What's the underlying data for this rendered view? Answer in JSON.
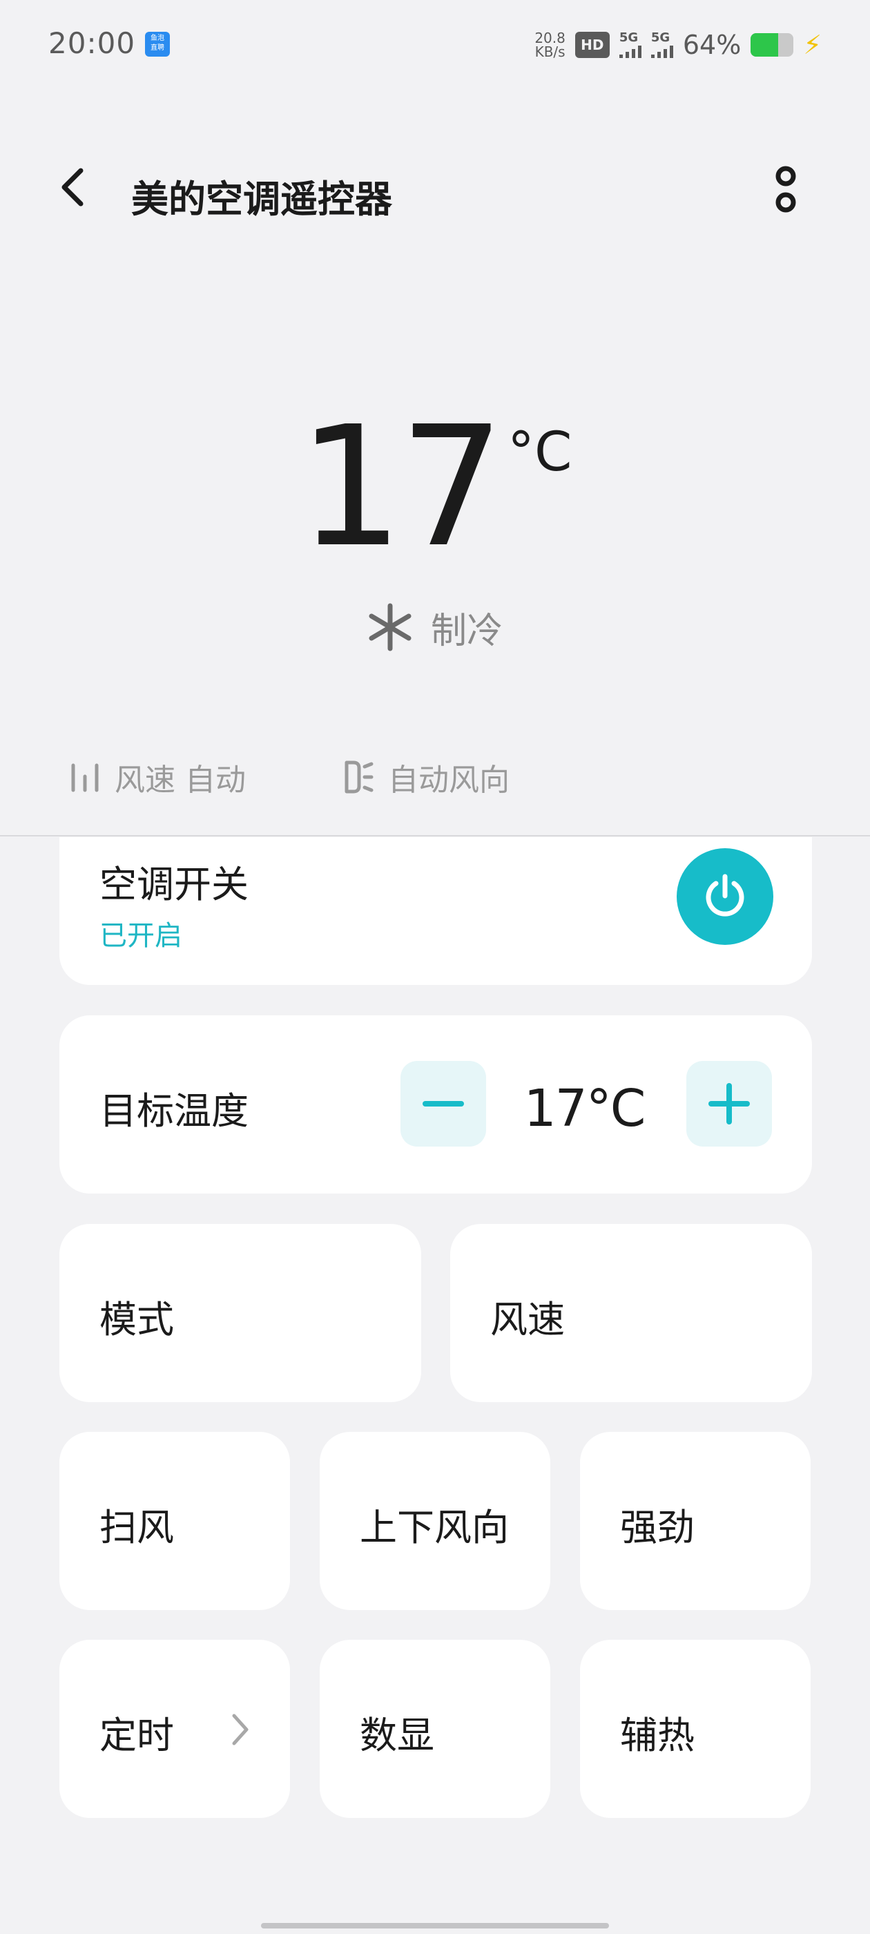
{
  "status_bar": {
    "time": "20:00",
    "app_icon_text": "鱼泡\n直聘",
    "speed_value": "20.8",
    "speed_unit": "KB/s",
    "hd_label": "HD",
    "signal1_label": "5G",
    "signal2_label": "5G",
    "battery_percent_text": "64%",
    "battery_level": 0.64,
    "charging": true
  },
  "header": {
    "title": "美的空调遥控器",
    "back_icon": "chevron-left-icon",
    "more_icon": "more-vertical-icon"
  },
  "display": {
    "temperature": "17",
    "unit": "°C",
    "mode_icon": "snowflake-icon",
    "mode": "制冷",
    "fan_speed_label": "风速 自动",
    "fan_speed_icon": "fan-speed-bars-icon",
    "direction_label": "自动风向",
    "direction_icon": "air-direction-icon"
  },
  "power": {
    "title": "空调开关",
    "status": "已开启",
    "icon": "power-icon"
  },
  "target_temp": {
    "label": "目标温度",
    "value": "17°C",
    "minus_icon": "minus-icon",
    "plus_icon": "plus-icon"
  },
  "controls": {
    "mode": "模式",
    "fan_speed": "风速",
    "swing": "扫风",
    "vertical_direction": "上下风向",
    "turbo": "强劲",
    "timer": "定时",
    "display": "数显",
    "aux_heat": "辅热"
  },
  "colors": {
    "accent": "#17bcc9",
    "accent_light": "#e6f6f8",
    "status_text": "#1fb6c4",
    "background": "#f2f2f4",
    "card": "#ffffff",
    "battery": "#2dc64a",
    "charging": "#f2c30a"
  }
}
